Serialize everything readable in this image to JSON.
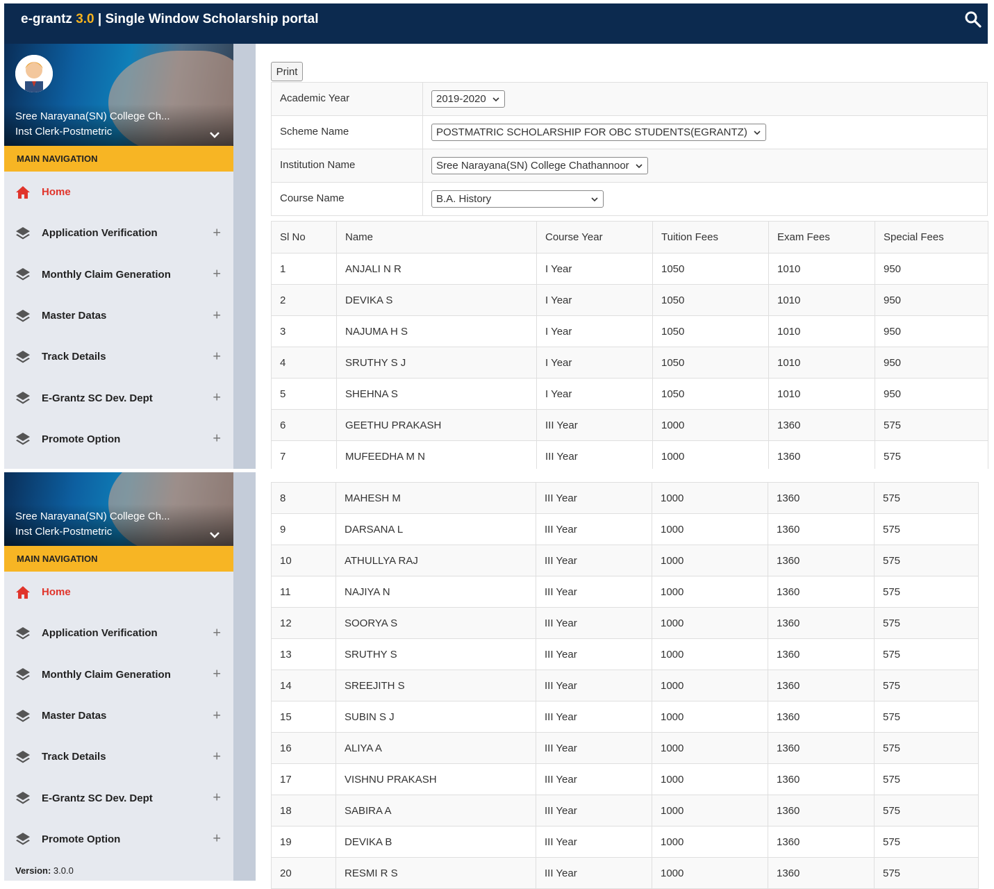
{
  "header": {
    "brand_name": "e-grantz",
    "brand_version": "3.0",
    "brand_separator": " | ",
    "portal_title": "Single Window Scholarship portal",
    "search_icon": "search-icon"
  },
  "profile": {
    "institution": "Sree Narayana(SN) College Ch...",
    "role": "Inst Clerk-Postmetric"
  },
  "sidebar": {
    "section_title": "MAIN NAVIGATION",
    "items": [
      {
        "label": "Home",
        "icon": "home-icon"
      },
      {
        "label": "Application Verification",
        "icon": "layers-icon",
        "expand": "+"
      },
      {
        "label": "Monthly Claim Generation",
        "icon": "layers-icon",
        "expand": "+"
      },
      {
        "label": "Master Datas",
        "icon": "layers-icon",
        "expand": "+"
      },
      {
        "label": "Track Details",
        "icon": "layers-icon",
        "expand": "+"
      },
      {
        "label": "E-Grantz SC Dev. Dept",
        "icon": "layers-icon",
        "expand": "+"
      },
      {
        "label": "Promote Option",
        "icon": "layers-icon",
        "expand": "+"
      }
    ],
    "version_label": "Version:",
    "version_value": "3.0.0"
  },
  "toolbar": {
    "print_label": "Print"
  },
  "filters": {
    "academic_year": {
      "label": "Academic Year",
      "value": "2019-2020"
    },
    "scheme_name": {
      "label": "Scheme Name",
      "value": "POSTMATRIC SCHOLARSHIP FOR OBC STUDENTS(EGRANTZ)"
    },
    "institution_name": {
      "label": "Institution Name",
      "value": "Sree Narayana(SN) College Chathannoor"
    },
    "course_name": {
      "label": "Course Name",
      "value": "B.A. History"
    }
  },
  "table": {
    "columns": [
      "Sl No",
      "Name",
      "Course Year",
      "Tuition Fees",
      "Exam Fees",
      "Special Fees"
    ],
    "rows": [
      [
        "1",
        "ANJALI N R",
        "I Year",
        "1050",
        "1010",
        "950"
      ],
      [
        "2",
        "DEVIKA S",
        "I Year",
        "1050",
        "1010",
        "950"
      ],
      [
        "3",
        "NAJUMA H S",
        "I Year",
        "1050",
        "1010",
        "950"
      ],
      [
        "4",
        "SRUTHY S J",
        "I Year",
        "1050",
        "1010",
        "950"
      ],
      [
        "5",
        "SHEHNA S",
        "I Year",
        "1050",
        "1010",
        "950"
      ],
      [
        "6",
        "GEETHU PRAKASH",
        "III Year",
        "1000",
        "1360",
        "575"
      ],
      [
        "7",
        "MUFEEDHA M N",
        "III Year",
        "1000",
        "1360",
        "575"
      ],
      [
        "8",
        "MAHESH M",
        "III Year",
        "1000",
        "1360",
        "575"
      ],
      [
        "9",
        "DARSANA L",
        "III Year",
        "1000",
        "1360",
        "575"
      ],
      [
        "10",
        "ATHULLYA RAJ",
        "III Year",
        "1000",
        "1360",
        "575"
      ],
      [
        "11",
        "NAJIYA N",
        "III Year",
        "1000",
        "1360",
        "575"
      ],
      [
        "12",
        "SOORYA S",
        "III Year",
        "1000",
        "1360",
        "575"
      ],
      [
        "13",
        "SRUTHY S",
        "III Year",
        "1000",
        "1360",
        "575"
      ],
      [
        "14",
        "SREEJITH S",
        "III Year",
        "1000",
        "1360",
        "575"
      ],
      [
        "15",
        "SUBIN S J",
        "III Year",
        "1000",
        "1360",
        "575"
      ],
      [
        "16",
        "ALIYA A",
        "III Year",
        "1000",
        "1360",
        "575"
      ],
      [
        "17",
        "VISHNU PRAKASH",
        "III Year",
        "1000",
        "1360",
        "575"
      ],
      [
        "18",
        "SABIRA A",
        "III Year",
        "1000",
        "1360",
        "575"
      ],
      [
        "19",
        "DEVIKA B",
        "III Year",
        "1000",
        "1360",
        "575"
      ],
      [
        "20",
        "RESMI R S",
        "III Year",
        "1000",
        "1360",
        "575"
      ]
    ]
  },
  "colors": {
    "header_bg": "#0c2a4f",
    "brand_version": "#f5b21f",
    "nav_section_bg": "#f7b524",
    "home_red": "#e0342b",
    "sidebar_bg": "#e6e9ef"
  }
}
